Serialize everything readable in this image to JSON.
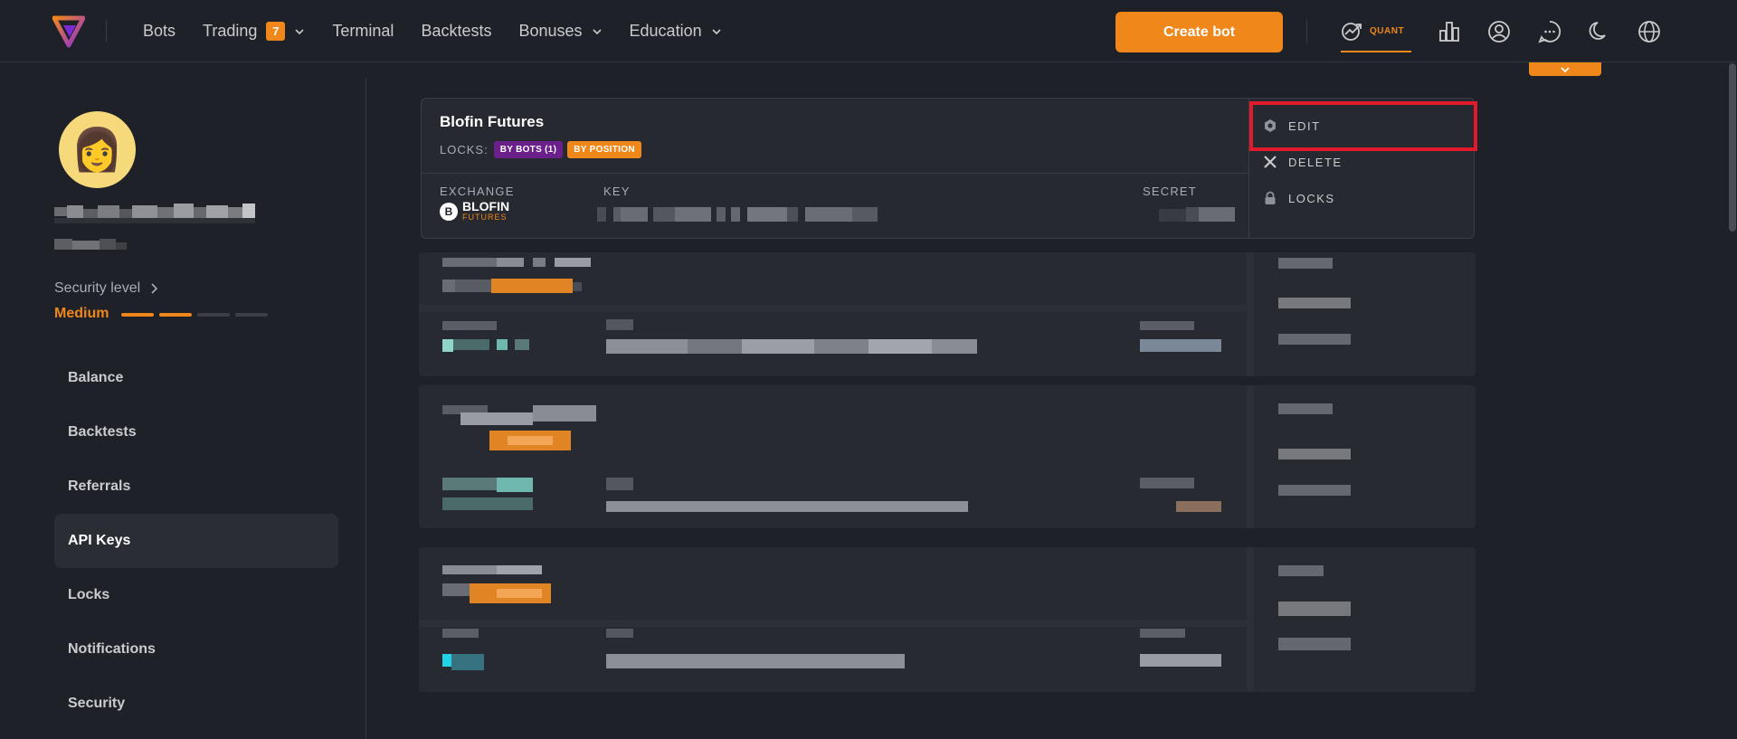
{
  "nav": {
    "items": [
      {
        "label": "Bots"
      },
      {
        "label": "Trading",
        "badge": "7"
      },
      {
        "label": "Terminal"
      },
      {
        "label": "Backtests"
      },
      {
        "label": "Bonuses"
      },
      {
        "label": "Education"
      }
    ],
    "create_bot": "Create bot",
    "quant_label": "QUANT"
  },
  "sidebar": {
    "security_level_label": "Security level",
    "security_level_value": "Medium",
    "security_level_filled": 2,
    "security_level_total": 4,
    "items": [
      {
        "label": "Balance"
      },
      {
        "label": "Backtests"
      },
      {
        "label": "Referrals"
      },
      {
        "label": "API Keys",
        "active": true
      },
      {
        "label": "Locks"
      },
      {
        "label": "Notifications"
      },
      {
        "label": "Security"
      }
    ]
  },
  "api_card": {
    "title": "Blofin Futures",
    "locks_label": "LOCKS:",
    "lock_badges": [
      "BY BOTS (1)",
      "BY POSITION"
    ],
    "columns": {
      "exchange": "EXCHANGE",
      "key": "KEY",
      "secret": "SECRET"
    },
    "exchange_name": "BLOFIN",
    "exchange_sub": "FUTURES",
    "exchange_logo_letter": "B",
    "actions": {
      "edit": "EDIT",
      "delete": "DELETE",
      "locks": "LOCKS"
    }
  },
  "colors": {
    "accent": "#f0871a",
    "background": "#1f2128",
    "card": "#262930",
    "highlight": "#e01a2b",
    "badge_purple": "#6b1f8a"
  }
}
